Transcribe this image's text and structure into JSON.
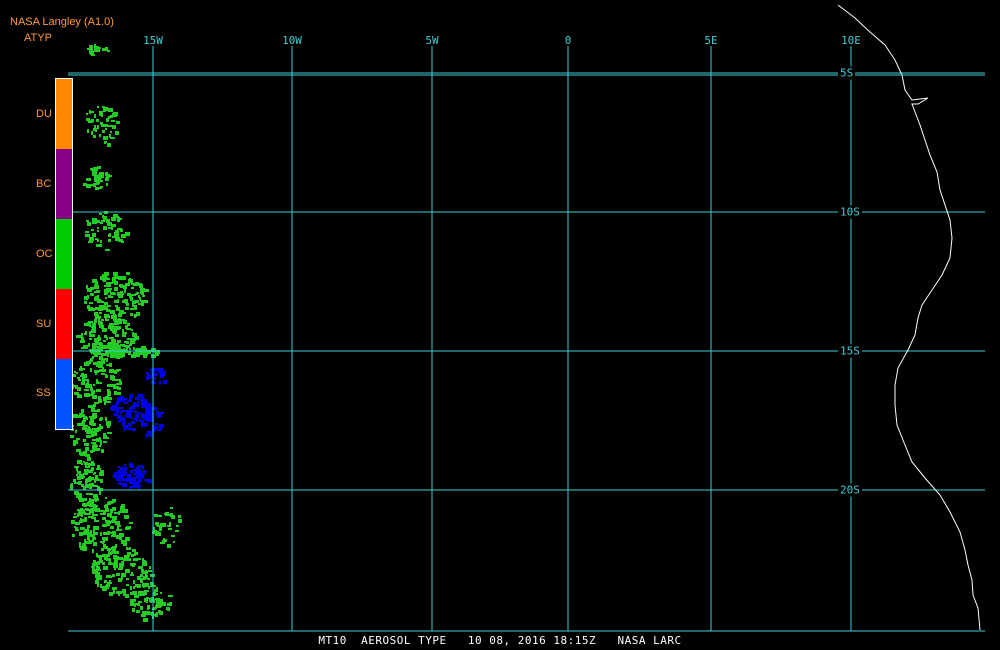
{
  "header": {
    "source": "NASA Langley (A1.0)",
    "product": "ATYP"
  },
  "grid": {
    "longitude_labels": [
      "15W",
      "10W",
      "5W",
      "0",
      "5E",
      "10E"
    ],
    "latitude_labels": [
      "5S",
      "10S",
      "15S",
      "20S"
    ],
    "line_color": "#3ccfd6"
  },
  "legend": {
    "items": [
      {
        "label": "DU",
        "color": "#ff8800"
      },
      {
        "label": "BC",
        "color": "#880088"
      },
      {
        "label": "OC",
        "color": "#00cc00"
      },
      {
        "label": "SU",
        "color": "#ff0000"
      },
      {
        "label": "SS",
        "color": "#0055ff"
      }
    ]
  },
  "map": {
    "background": "#000000",
    "coastline_color": "#ffffff",
    "aerosol_colors": {
      "OC": "#22cc22",
      "SS": "#0000ee"
    }
  },
  "footer": {
    "caption": "MT10  AEROSOL TYPE   10 08, 2016 18:15Z   NASA LARC"
  }
}
